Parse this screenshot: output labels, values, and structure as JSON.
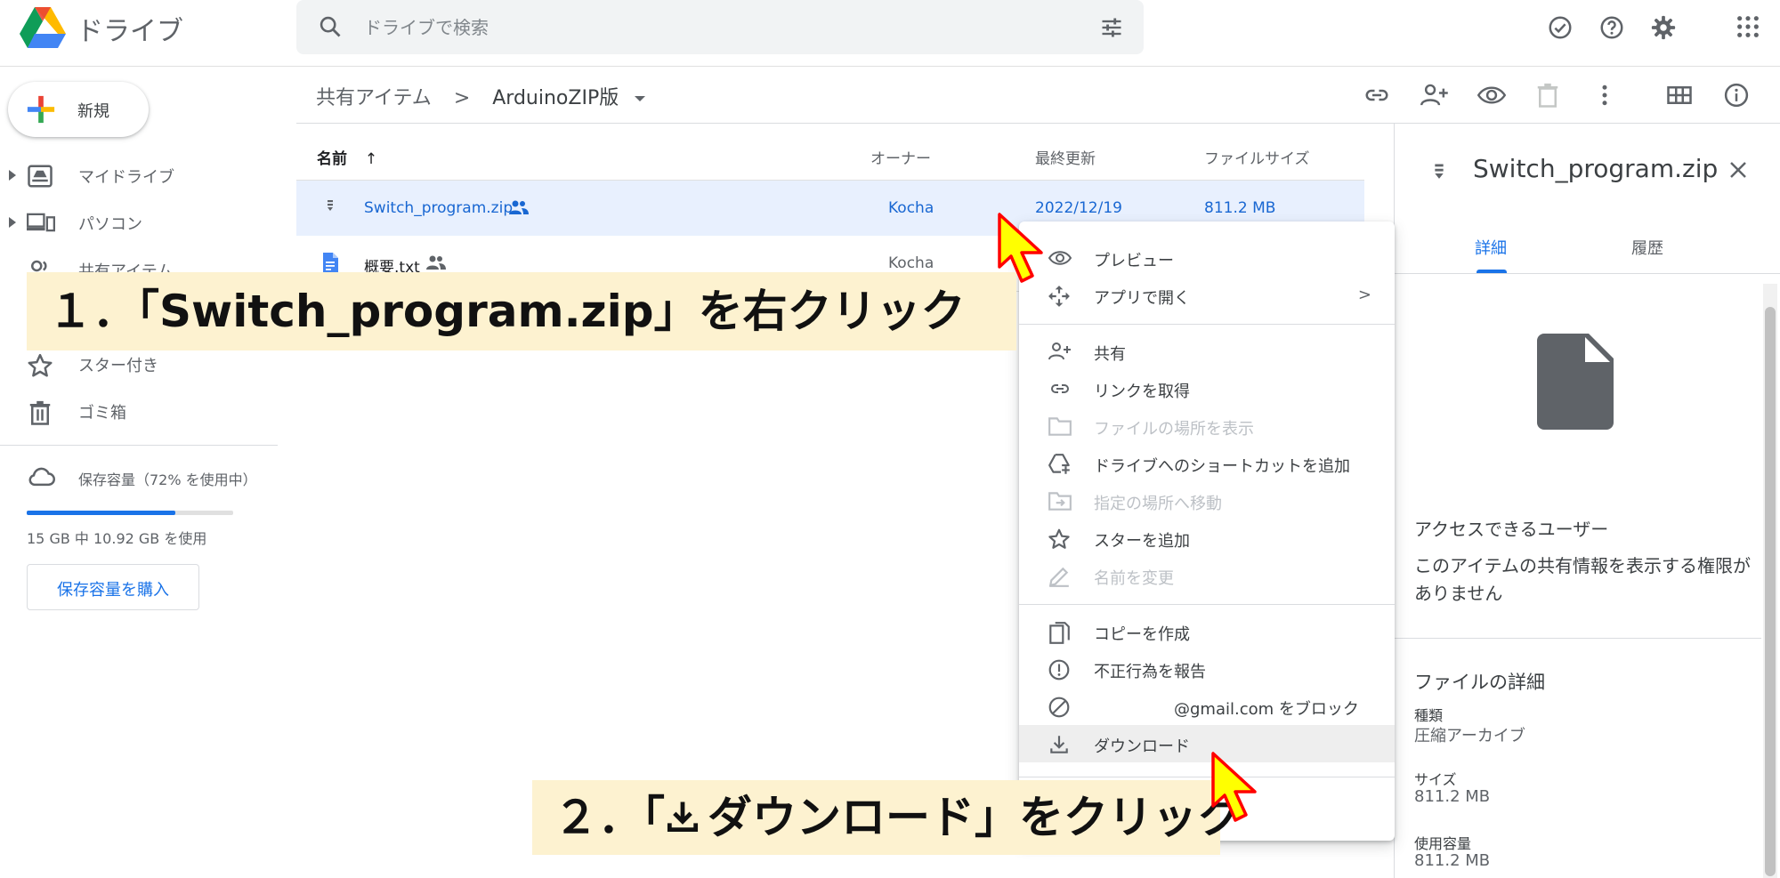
{
  "header": {
    "product_name": "ドライブ",
    "search_placeholder": "ドライブで検索"
  },
  "sidebar": {
    "new_button_label": "新規",
    "items": [
      {
        "label": "マイドライブ",
        "icon": "my-drive-icon"
      },
      {
        "label": "パソコン",
        "icon": "computers-icon"
      },
      {
        "label": "共有アイテム",
        "icon": "shared-icon"
      },
      {
        "label": "スター付き",
        "icon": "star-icon"
      },
      {
        "label": "ゴミ箱",
        "icon": "trash-icon"
      }
    ],
    "storage": {
      "label": "保存容量（72% を使用中）",
      "used_fraction": 0.72,
      "detail": "15 GB 中 10.92 GB を使用",
      "buy_button_label": "保存容量を購入"
    }
  },
  "breadcrumb": {
    "parent": "共有アイテム",
    "separator": ">",
    "current": "ArduinoZIP版"
  },
  "file_list": {
    "columns": [
      "名前",
      "オーナー",
      "最終更新",
      "ファイルサイズ"
    ],
    "sort_indicator": "↑",
    "rows": [
      {
        "name": "Switch_program.zip",
        "owner": "Kocha",
        "modified": "2022/12/19",
        "size": "811.2 MB",
        "icon": "zip-file-icon"
      },
      {
        "name": "概要.txt",
        "owner": "Kocha",
        "modified": "",
        "size": "",
        "icon": "text-document-icon"
      }
    ]
  },
  "context_menu": {
    "items": [
      {
        "label": "プレビュー",
        "icon": "eye-icon",
        "disabled": false
      },
      {
        "label": "アプリで開く",
        "icon": "open-with-icon",
        "disabled": false,
        "submenu_arrow": ">"
      },
      {
        "label": "共有",
        "icon": "person-add-icon",
        "disabled": false
      },
      {
        "label": "リンクを取得",
        "icon": "link-icon",
        "disabled": false
      },
      {
        "label": "ファイルの場所を表示",
        "icon": "folder-icon",
        "disabled": true
      },
      {
        "label": "ドライブへのショートカットを追加",
        "icon": "add-shortcut-icon",
        "disabled": false
      },
      {
        "label": "指定の場所へ移動",
        "icon": "move-icon",
        "disabled": true
      },
      {
        "label": "スターを追加",
        "icon": "star-icon",
        "disabled": false
      },
      {
        "label": "名前を変更",
        "icon": "pencil-icon",
        "disabled": true
      },
      {
        "label": "コピーを作成",
        "icon": "copy-icon",
        "disabled": false
      },
      {
        "label": "不正行為を報告",
        "icon": "report-icon",
        "disabled": false
      },
      {
        "label": "@gmail.com をブロック",
        "icon": "block-icon",
        "disabled": false
      },
      {
        "label": "ダウンロード",
        "icon": "download-icon",
        "disabled": false
      }
    ]
  },
  "details_panel": {
    "title": "Switch_program.zip",
    "tabs": [
      "詳細",
      "履歴"
    ],
    "access_title": "アクセスできるユーザー",
    "access_text": "このアイテムの共有情報を表示する権限がありません",
    "file_details_title": "ファイルの詳細",
    "fields": [
      {
        "key": "種類",
        "value": "圧縮アーカイブ"
      },
      {
        "key": "サイズ",
        "value": "811.2 MB"
      },
      {
        "key": "使用容量",
        "value": "811.2 MB"
      }
    ]
  },
  "annotations": {
    "step1": "１．「Switch_program.zip」を右クリック",
    "step2_prefix": "２．「",
    "step2_suffix": "ダウンロード」をクリック"
  },
  "colors": {
    "accent": "#1a73e8",
    "selected_row": "#e8f0fe",
    "callout_bg": "#fdf2d0",
    "cursor_fill": "#ffff00",
    "cursor_stroke": "#ff0000"
  }
}
